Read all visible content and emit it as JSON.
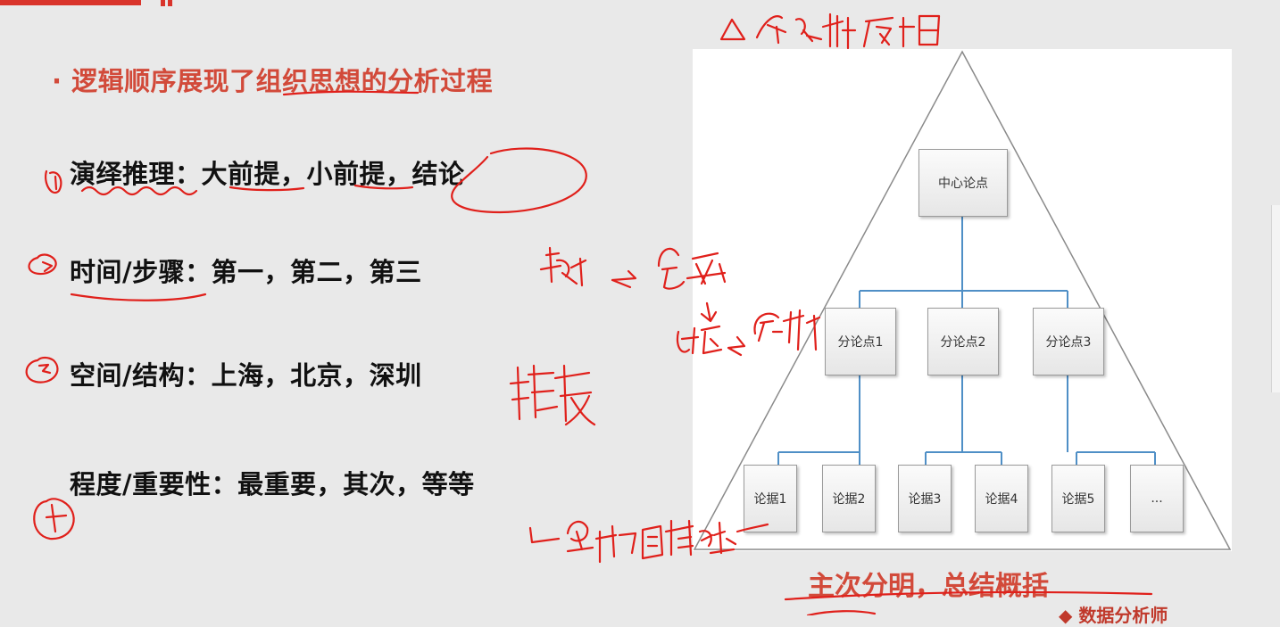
{
  "slide": {
    "headline": "· 逻辑顺序展现了组织思想的分析过程",
    "lines": [
      "演绎推理：大前提，小前提，结论",
      "时间/步骤：第一，第二，第三",
      "空间/结构：上海，北京，深圳",
      "程度/重要性：最重要，其次，等等"
    ],
    "caption": "主次分明，总结概括",
    "logo_text": "◆ 数据分析师"
  },
  "diagram": {
    "root": "中心论点",
    "points": [
      "分论点1",
      "分论点2",
      "分论点3"
    ],
    "evidence": [
      "论据1",
      "论据2",
      "论据3",
      "论据4",
      "论据5",
      "..."
    ]
  },
  "colors": {
    "accent_red": "#d24a3a",
    "connector_blue": "#4f8fc6",
    "ink_red": "#e0201b"
  }
}
